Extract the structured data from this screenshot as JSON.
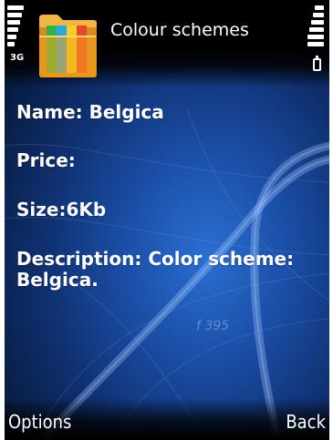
{
  "app_title": "Colour schemes",
  "status": {
    "network": "3G"
  },
  "details": {
    "name": "Name: Belgica",
    "price": "Price:",
    "size": "Size:6Kb",
    "description_line1": "Description: Color scheme:",
    "description_line2": "Belgica."
  },
  "softkeys": {
    "left": "Options",
    "right": "Back"
  },
  "background_map_label": "f 395",
  "colors": {
    "text": "#ffffff",
    "background_deep": "#0b2350",
    "background_mid": "#1b4fa8"
  },
  "icons": {
    "app_icon": "folder-colour-schemes-icon",
    "signal": "signal-strength-icon",
    "battery": "battery-icon"
  }
}
